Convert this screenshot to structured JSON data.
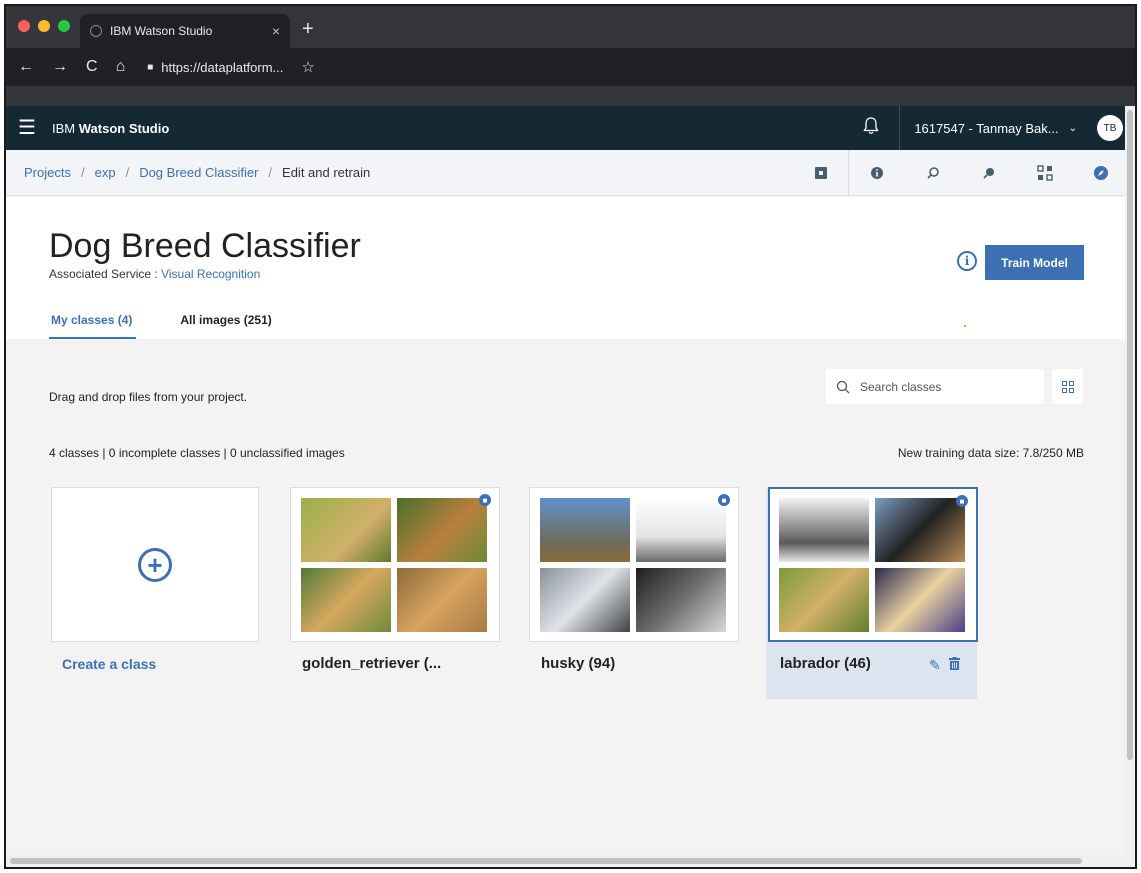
{
  "browser": {
    "tab_title": "IBM Watson Studio",
    "tab_close": "×",
    "new_tab": "+",
    "url": "https://dataplatform...",
    "colors": {
      "close": "#ff5f57",
      "minimize": "#febc2e",
      "maximize": "#28c840"
    }
  },
  "app": {
    "brand_prefix": "IBM",
    "brand_name": "Watson Studio",
    "account": "1617547 - Tanmay Bak...",
    "avatar_initials": "TB"
  },
  "breadcrumb": {
    "items": [
      "Projects",
      "exp",
      "Dog Breed Classifier"
    ],
    "separator": "/",
    "current": "Edit and retrain"
  },
  "toolbar_icons": [
    "select-icon",
    "info-icon",
    "search-model-icon",
    "search-tool-icon",
    "grid-nav-icon",
    "compass-icon"
  ],
  "page": {
    "title": "Dog Breed Classifier",
    "service_label": "Associated Service :",
    "service_name": "Visual Recognition",
    "train_button": "Train Model",
    "tabs": [
      {
        "label": "My classes (4)",
        "active": true
      },
      {
        "label": "All images (251)",
        "active": false
      }
    ]
  },
  "content": {
    "drag_text": "Drag and drop files from your project.",
    "search_placeholder": "Search classes",
    "stats": "4 classes | 0 incomplete classes | 0 unclassified images",
    "training_size": "New training data size: 7.8/250 MB",
    "create_label": "Create a class",
    "classes": [
      {
        "label": "golden_retriever (...",
        "colors": [
          "#7f9a3a",
          "#5e7b2e",
          "#4f7a3a",
          "#b8894a"
        ]
      },
      {
        "label": "husky (94)",
        "colors": [
          "#5f92c8",
          "#e9e9e9",
          "#6f7780",
          "#3a3a3a"
        ]
      },
      {
        "label": "labrador (46)",
        "colors": [
          "#c9c9c9",
          "#6b86a6",
          "#6f8f3a",
          "#3b3760"
        ]
      }
    ]
  }
}
